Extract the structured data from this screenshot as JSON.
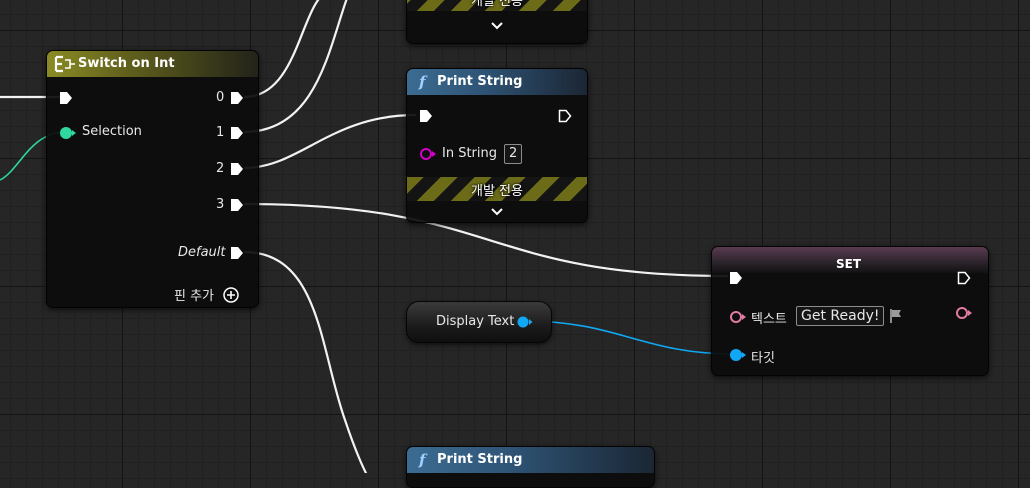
{
  "colors": {
    "exec": "#ffffff",
    "int_pin": "#2ed89e",
    "string_pin": "#d400c8",
    "text_pin": "#e27aa4",
    "object_pin": "#10a8f4",
    "switch_header": "#8b8b25",
    "function_header": "#3c6c92"
  },
  "switch_node": {
    "title": "Switch on Int",
    "title_icon": "switch-icon",
    "selection_label": "Selection",
    "outputs": [
      "0",
      "1",
      "2",
      "3"
    ],
    "default_label": "Default",
    "add_pin_label": "핀 추가",
    "add_pin_icon": "plus-circle-icon"
  },
  "top_partial_node": {
    "dev_only_label": "개발 전용"
  },
  "print_string_node": {
    "title": "Print String",
    "title_icon": "function-icon",
    "in_string_label": "In String",
    "in_string_value": "2",
    "dev_only_label": "개발 전용"
  },
  "set_node": {
    "title": "SET",
    "text_label": "텍스트",
    "text_value": "Get Ready!",
    "flag_icon": "localization-flag-icon",
    "target_label": "타깃"
  },
  "display_text_node": {
    "label": "Display Text"
  },
  "bottom_partial_node": {
    "title": "Print String",
    "title_icon": "function-icon"
  }
}
